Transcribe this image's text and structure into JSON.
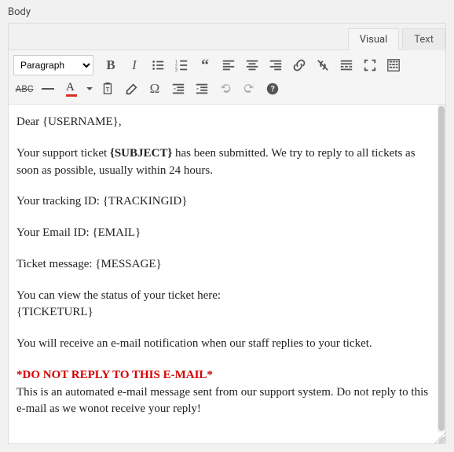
{
  "field_label": "Body",
  "tabs": {
    "visual": "Visual",
    "text": "Text",
    "active": "visual"
  },
  "format_select": "Paragraph",
  "content": {
    "p1_prefix": "Dear ",
    "p1_token": "{USERNAME}",
    "p1_suffix": ",",
    "p2_a": "Your support ticket ",
    "p2_bold": "{SUBJECT}",
    "p2_b": " has been submitted. We try to reply to all tickets as soon as possible, usually within 24 hours.",
    "p3": "Your tracking ID: {TRACKINGID}",
    "p4": "Your Email ID: {EMAIL}",
    "p5": "Ticket message: {MESSAGE}",
    "p6_a": "You can view the status of your ticket here:",
    "p6_b": "{TICKETURL}",
    "p7": "You will receive an e-mail notification when our staff replies to your ticket.",
    "p8_red": "*DO NOT REPLY TO THIS E-MAIL*",
    "p8_rest": "This is an automated e-mail message sent from our support system. Do not reply to this e-mail as we wonot receive your reply!"
  }
}
